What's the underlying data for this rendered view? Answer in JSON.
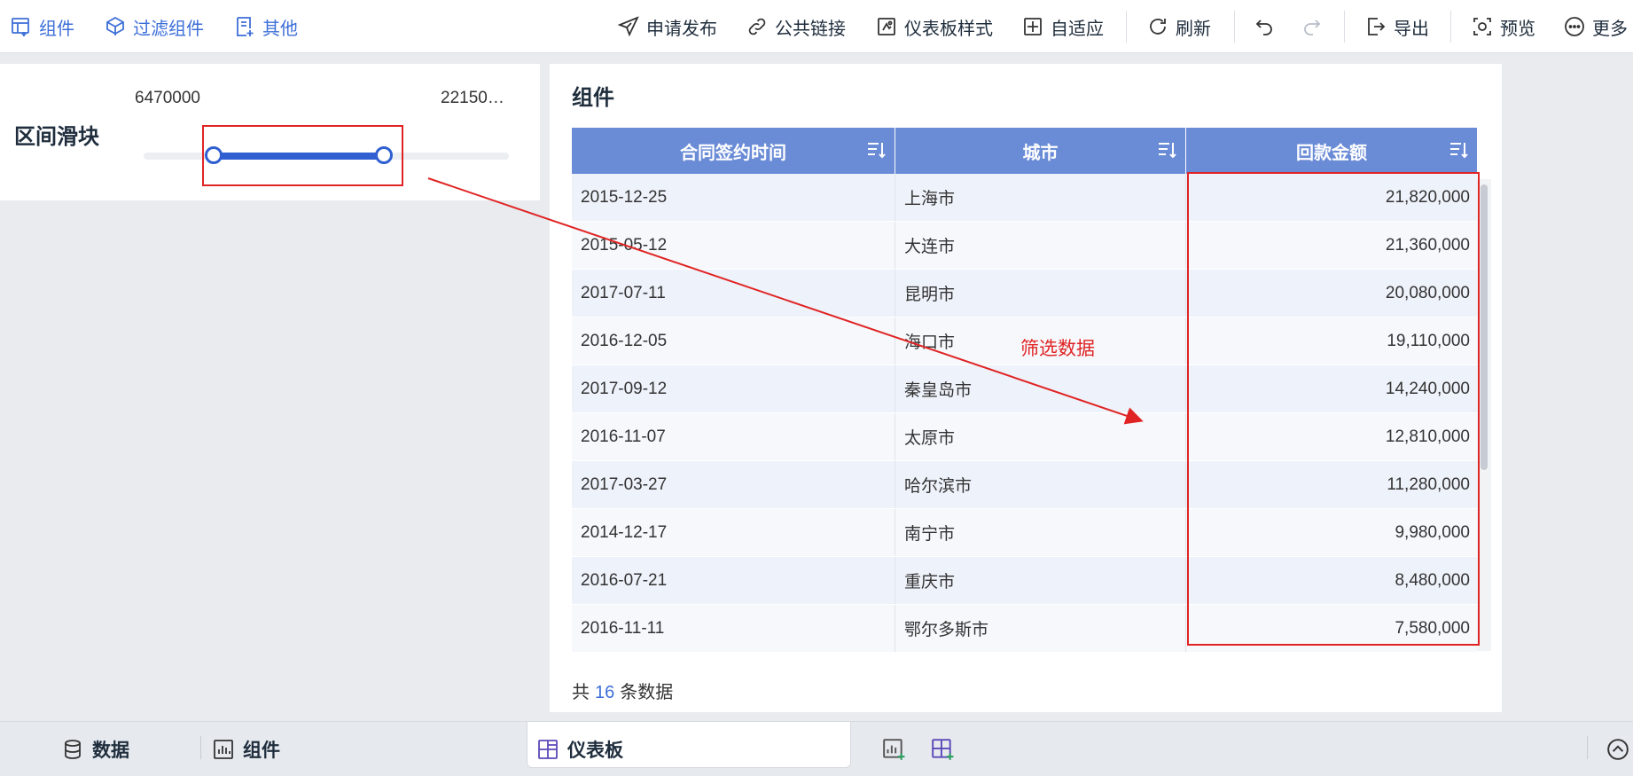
{
  "toolbar": {
    "left": [
      {
        "label": "组件",
        "icon": "add-component-icon"
      },
      {
        "label": "过滤组件",
        "icon": "filter-component-icon"
      },
      {
        "label": "其他",
        "icon": "other-icon"
      }
    ],
    "right": [
      {
        "label": "申请发布",
        "icon": "send-icon"
      },
      {
        "label": "公共链接",
        "icon": "link-icon"
      },
      {
        "label": "仪表板样式",
        "icon": "style-icon"
      },
      {
        "label": "自适应",
        "icon": "adaptive-icon"
      },
      {
        "label": "刷新",
        "icon": "refresh-icon"
      },
      {
        "label": "导出",
        "icon": "export-icon"
      },
      {
        "label": "预览",
        "icon": "preview-icon"
      },
      {
        "label": "更多",
        "icon": "more-icon"
      }
    ]
  },
  "slider": {
    "title": "区间滑块",
    "min_label": "6470000",
    "max_label": "22150…"
  },
  "table": {
    "title": "组件",
    "columns": [
      "合同签约时间",
      "城市",
      "回款金额"
    ],
    "rows": [
      [
        "2015-12-25",
        "上海市",
        "21,820,000"
      ],
      [
        "2015-05-12",
        "大连市",
        "21,360,000"
      ],
      [
        "2017-07-11",
        "昆明市",
        "20,080,000"
      ],
      [
        "2016-12-05",
        "海口市",
        "19,110,000"
      ],
      [
        "2017-09-12",
        "秦皇岛市",
        "14,240,000"
      ],
      [
        "2016-11-07",
        "太原市",
        "12,810,000"
      ],
      [
        "2017-03-27",
        "哈尔滨市",
        "11,280,000"
      ],
      [
        "2014-12-17",
        "南宁市",
        "9,980,000"
      ],
      [
        "2016-07-21",
        "重庆市",
        "8,480,000"
      ],
      [
        "2016-11-11",
        "鄂尔多斯市",
        "7,580,000"
      ]
    ],
    "footer": {
      "prefix": "共",
      "count": "16",
      "suffix": "条数据"
    }
  },
  "annotation": {
    "text": "筛选数据",
    "color": "#e02424"
  },
  "bottombar": {
    "data_tab": "数据",
    "component_tab": "组件",
    "dashboard_tab": "仪表板"
  },
  "colors": {
    "accent": "#3d6fd8",
    "table_header": "#6a8bd6",
    "slider_range": "#2f5fd0"
  }
}
